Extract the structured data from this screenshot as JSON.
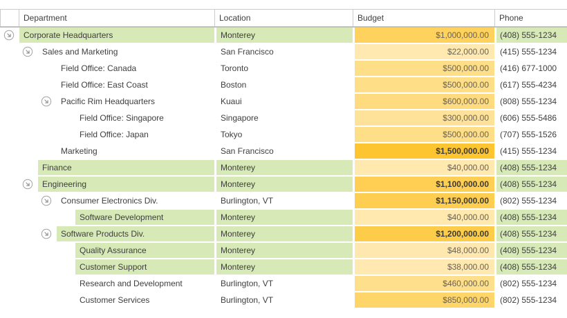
{
  "table": {
    "columns": [
      {
        "key": "department",
        "label": "Department"
      },
      {
        "key": "location",
        "label": "Location"
      },
      {
        "key": "budget",
        "label": "Budget"
      },
      {
        "key": "phone",
        "label": "Phone"
      }
    ],
    "rows": [
      {
        "level": 0,
        "expanded": true,
        "department": "Corporate Headquarters",
        "location": "Monterey",
        "budget_value": 1000000,
        "budget": "$1,000,000.00",
        "phone": "(408) 555-1234",
        "highlight": true
      },
      {
        "level": 1,
        "expanded": true,
        "department": "Sales and Marketing",
        "location": "San Francisco",
        "budget_value": 22000,
        "budget": "$22,000.00",
        "phone": "(415) 555-1234",
        "highlight": false
      },
      {
        "level": 2,
        "expanded": null,
        "department": "Field Office: Canada",
        "location": "Toronto",
        "budget_value": 500000,
        "budget": "$500,000.00",
        "phone": "(416) 677-1000",
        "highlight": false
      },
      {
        "level": 2,
        "expanded": null,
        "department": "Field Office: East Coast",
        "location": "Boston",
        "budget_value": 500000,
        "budget": "$500,000.00",
        "phone": "(617) 555-4234",
        "highlight": false
      },
      {
        "level": 2,
        "expanded": true,
        "department": "Pacific Rim Headquarters",
        "location": "Kuaui",
        "budget_value": 600000,
        "budget": "$600,000.00",
        "phone": "(808) 555-1234",
        "highlight": false
      },
      {
        "level": 3,
        "expanded": null,
        "department": "Field Office: Singapore",
        "location": "Singapore",
        "budget_value": 300000,
        "budget": "$300,000.00",
        "phone": "(606) 555-5486",
        "highlight": false
      },
      {
        "level": 3,
        "expanded": null,
        "department": "Field Office: Japan",
        "location": "Tokyo",
        "budget_value": 500000,
        "budget": "$500,000.00",
        "phone": "(707) 555-1526",
        "highlight": false
      },
      {
        "level": 2,
        "expanded": null,
        "department": "Marketing",
        "location": "San Francisco",
        "budget_value": 1500000,
        "budget": "$1,500,000.00",
        "phone": "(415) 555-1234",
        "highlight": false
      },
      {
        "level": 1,
        "expanded": null,
        "department": "Finance",
        "location": "Monterey",
        "budget_value": 40000,
        "budget": "$40,000.00",
        "phone": "(408) 555-1234",
        "highlight": true
      },
      {
        "level": 1,
        "expanded": true,
        "department": "Engineering",
        "location": "Monterey",
        "budget_value": 1100000,
        "budget": "$1,100,000.00",
        "phone": "(408) 555-1234",
        "highlight": true
      },
      {
        "level": 2,
        "expanded": true,
        "department": "Consumer Electronics Div.",
        "location": "Burlington, VT",
        "budget_value": 1150000,
        "budget": "$1,150,000.00",
        "phone": "(802) 555-1234",
        "highlight": false
      },
      {
        "level": 3,
        "expanded": null,
        "department": "Software Development",
        "location": "Monterey",
        "budget_value": 40000,
        "budget": "$40,000.00",
        "phone": "(408) 555-1234",
        "highlight": true
      },
      {
        "level": 2,
        "expanded": true,
        "department": "Software Products Div.",
        "location": "Monterey",
        "budget_value": 1200000,
        "budget": "$1,200,000.00",
        "phone": "(408) 555-1234",
        "highlight": true
      },
      {
        "level": 3,
        "expanded": null,
        "department": "Quality Assurance",
        "location": "Monterey",
        "budget_value": 48000,
        "budget": "$48,000.00",
        "phone": "(408) 555-1234",
        "highlight": true
      },
      {
        "level": 3,
        "expanded": null,
        "department": "Customer Support",
        "location": "Monterey",
        "budget_value": 38000,
        "budget": "$38,000.00",
        "phone": "(408) 555-1234",
        "highlight": true
      },
      {
        "level": 3,
        "expanded": null,
        "department": "Research and Development",
        "location": "Burlington, VT",
        "budget_value": 460000,
        "budget": "$460,000.00",
        "phone": "(802) 555-1234",
        "highlight": false
      },
      {
        "level": 3,
        "expanded": null,
        "department": "Customer Services",
        "location": "Burlington, VT",
        "budget_value": 850000,
        "budget": "$850,000.00",
        "phone": "(802) 555-1234",
        "highlight": false
      }
    ]
  },
  "formatting": {
    "bold_budget_above": 1000000,
    "row_highlight_color": "#d6e9b6",
    "budget_scale_min_color": "#ffe9b1",
    "budget_scale_max_color": "#fdc630"
  },
  "icons": {
    "expand": "circled-arrow-down-right"
  }
}
